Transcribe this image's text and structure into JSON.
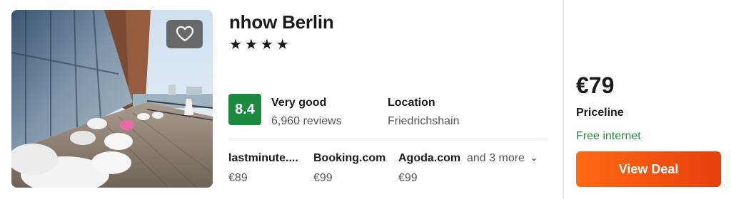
{
  "hotel": {
    "name": "nhow Berlin",
    "stars": "★★★★",
    "star_count": 4
  },
  "photo": {
    "alt_icon": "hotel-photo"
  },
  "favorite": {
    "icon": "heart-outline-icon"
  },
  "rating": {
    "score": "8.4",
    "label": "Very good",
    "reviews": "6,960 reviews",
    "badge_color": "#1b8a3e"
  },
  "location": {
    "title": "Location",
    "value": "Friedrichshain"
  },
  "providers": [
    {
      "name": "lastminute....",
      "price": "€89"
    },
    {
      "name": "Booking.com",
      "price": "€99"
    },
    {
      "name": "Agoda.com",
      "price": "€99"
    }
  ],
  "more_providers": "and 3 more",
  "deal": {
    "price": "€79",
    "provider": "Priceline",
    "amenity": "Free internet",
    "button_label": "View Deal",
    "button_color": "#f05a14",
    "amenity_color": "#2a8a3e"
  }
}
